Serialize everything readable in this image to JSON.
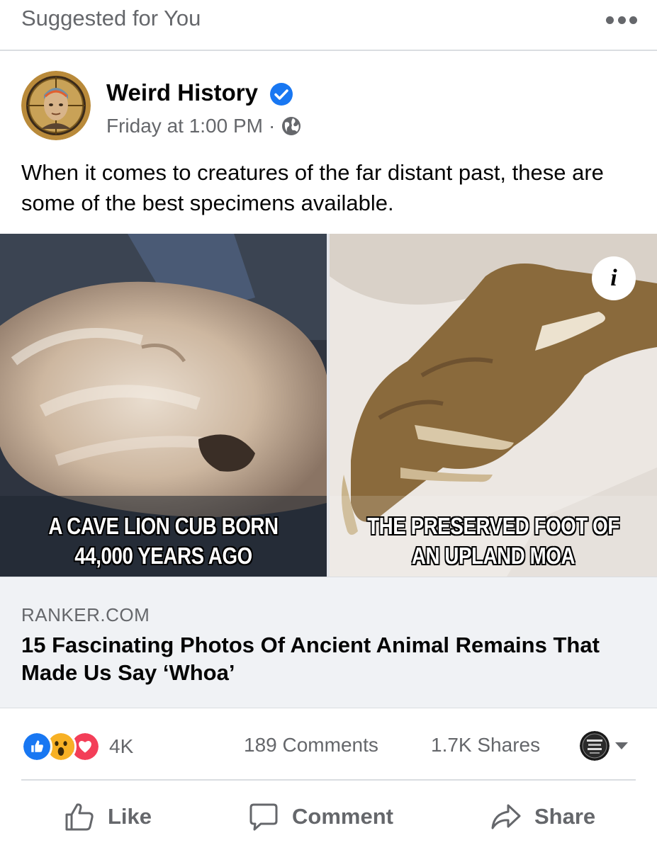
{
  "header": {
    "suggested_label": "Suggested for You",
    "more_icon": "more-dots-icon"
  },
  "post": {
    "page_name": "Weird History",
    "verified_icon": "verified-badge-icon",
    "timestamp": "Friday at 1:00 PM",
    "separator": "·",
    "privacy_icon": "globe-icon",
    "text": "When it comes to creatures of the far distant past, these are some of the best specimens available."
  },
  "link": {
    "image_left_caption": "A CAVE LION CUB BORN 44,000 YEARS AGO",
    "image_right_caption": "THE PRESERVED FOOT OF AN UPLAND MOA",
    "info_label": "i",
    "domain": "RANKER.COM",
    "title": "15 Fascinating Photos Of Ancient Animal Remains That Made Us Say ‘Whoa’"
  },
  "stats": {
    "reaction_icons": [
      "like-reaction-icon",
      "wow-reaction-icon",
      "love-reaction-icon"
    ],
    "reaction_count": "4K",
    "comments": "189 Comments",
    "shares": "1.7K Shares"
  },
  "actions": {
    "like": "Like",
    "comment": "Comment",
    "share": "Share"
  },
  "colors": {
    "facebook_blue": "#1877f2",
    "secondary_text": "#65676b",
    "love_red": "#f33e58",
    "wow_yellow": "#f7b125"
  }
}
